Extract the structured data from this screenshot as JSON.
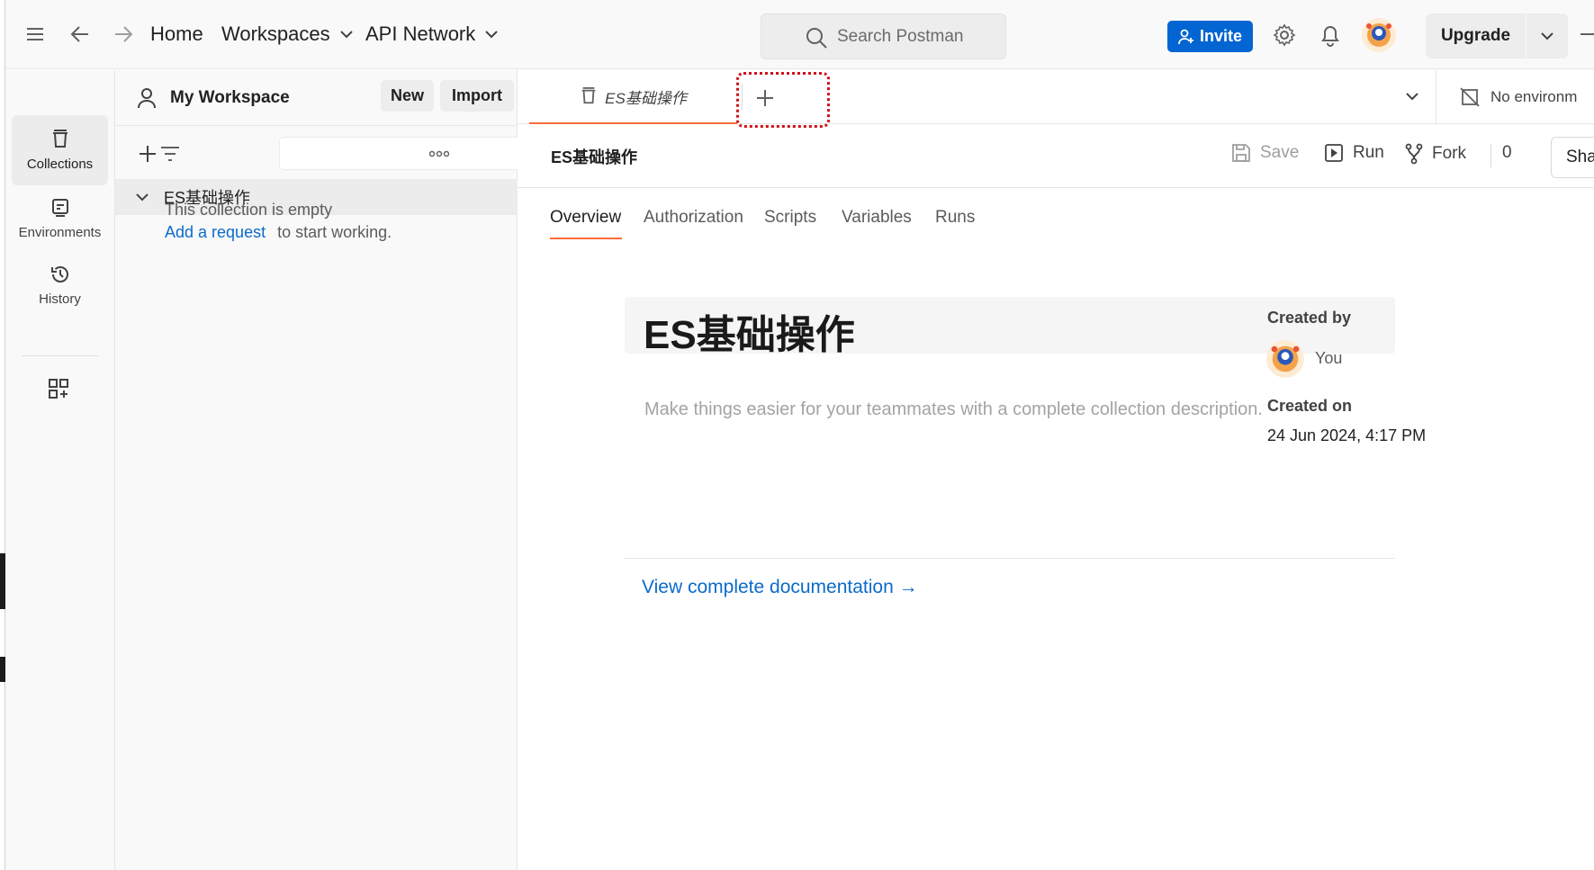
{
  "topbar": {
    "nav": {
      "home": "Home",
      "workspaces": "Workspaces",
      "api_network": "API Network"
    },
    "search_placeholder": "Search Postman",
    "invite_label": "Invite",
    "upgrade_label": "Upgrade"
  },
  "rail": {
    "items": [
      {
        "label": "Collections",
        "icon": "collections-icon",
        "active": true
      },
      {
        "label": "Environments",
        "icon": "environments-icon",
        "active": false
      },
      {
        "label": "History",
        "icon": "history-icon",
        "active": false
      }
    ]
  },
  "sidebar": {
    "workspace_name": "My Workspace",
    "new_label": "New",
    "import_label": "Import",
    "collection_name": "ES基础操作",
    "empty_text": "This collection is empty",
    "add_request_link": "Add a request",
    "start_working_text": "to start working."
  },
  "tabs": {
    "active_tab_label": "ES基础操作",
    "environment_label": "No environm"
  },
  "collection": {
    "header_title": "ES基础操作",
    "save_label": "Save",
    "run_label": "Run",
    "fork_label": "Fork",
    "fork_count": "0",
    "share_label": "Share",
    "subtabs": [
      "Overview",
      "Authorization",
      "Scripts",
      "Variables",
      "Runs"
    ],
    "doc_title": "ES基础操作",
    "doc_description_placeholder": "Make things easier for your teammates with a complete collection description.",
    "view_docs_link": "View complete documentation →",
    "created_by_label": "Created by",
    "created_by_value": "You",
    "created_on_label": "Created on",
    "created_on_value": "24 Jun 2024, 4:17 PM"
  },
  "colors": {
    "accent": "#ff6c37",
    "primary_button": "#0265d2",
    "link": "#0b6bcb",
    "highlight_annotation": "#d2101a"
  }
}
